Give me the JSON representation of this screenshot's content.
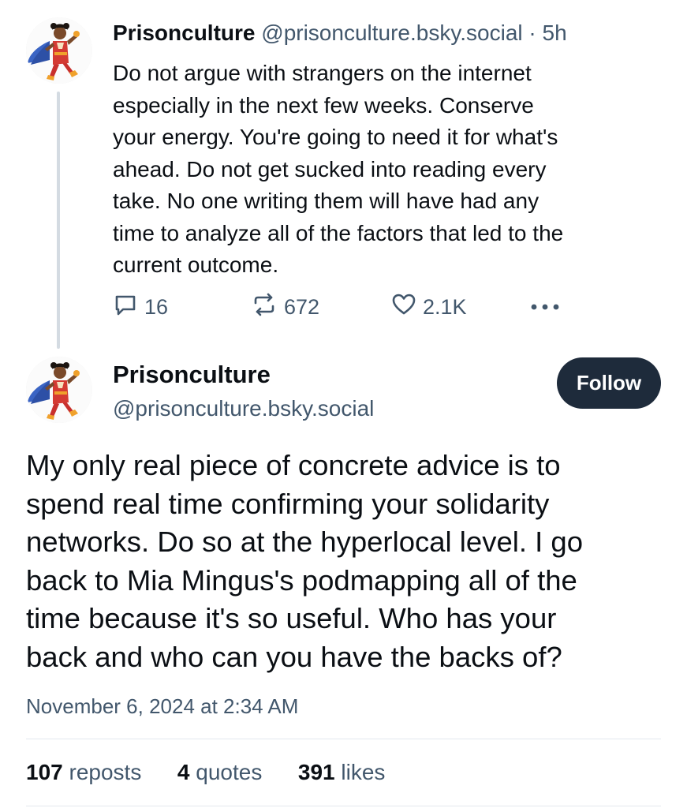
{
  "reply_post": {
    "author_name": "Prisonculture",
    "author_handle": "@prisonculture.bsky.social",
    "separator": "·",
    "time_ago": "5h",
    "text": "Do not argue with strangers on the internet\nespecially in the next few weeks. Conserve\nyour energy. You're going to need it for what's\nahead. Do not get sucked into reading every\ntake. No one writing them will have had any\ntime to analyze all of the factors that led to the\ncurrent outcome.",
    "replies_count": "16",
    "reposts_count": "672",
    "likes_count": "2.1K"
  },
  "main_post": {
    "author_name": "Prisonculture",
    "author_handle": "@prisonculture.bsky.social",
    "follow_label": "Follow",
    "text": "My only real piece of concrete advice is to\nspend real time confirming your solidarity\nnetworks. Do so at the hyperlocal level. I go\nback to Mia Mingus's podmapping all of the\ntime because it's so useful. Who has your\nback and who can you have the backs of?",
    "timestamp": "November 6, 2024 at 2:34 AM",
    "stats": {
      "reposts_num": "107",
      "reposts_label": "reposts",
      "quotes_num": "4",
      "quotes_label": "quotes",
      "likes_num": "391",
      "likes_label": "likes"
    }
  },
  "icons": {
    "reply": "speech-bubble-icon",
    "repost": "repost-arrows-icon",
    "like": "heart-icon",
    "more": "ellipsis-icon"
  },
  "colors": {
    "text": "#0b0f14",
    "muted": "#42576c",
    "follow_bg": "#1e2b3b",
    "thread_line": "#d4dbe2"
  }
}
